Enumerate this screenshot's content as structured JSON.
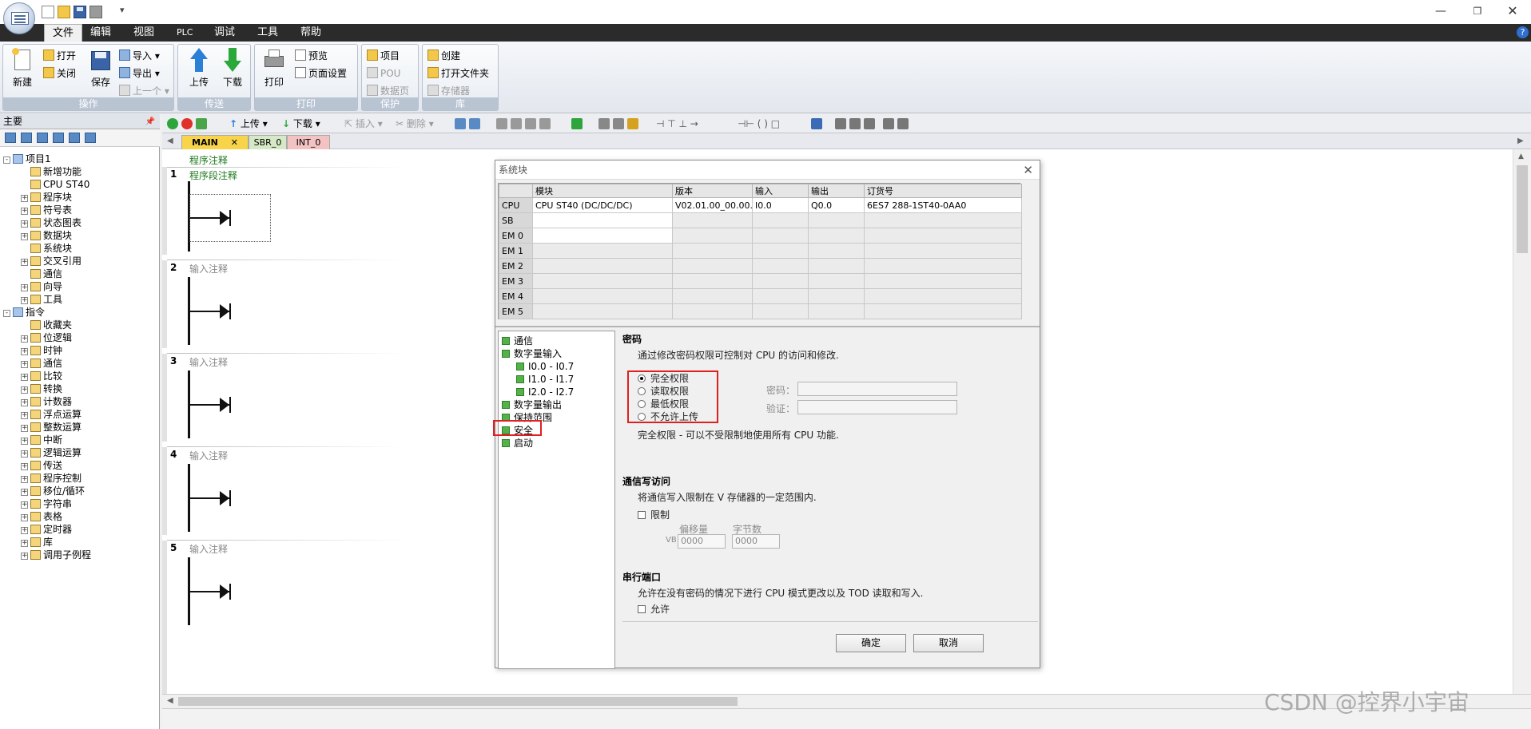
{
  "menu": {
    "items": [
      "文件",
      "编辑",
      "视图",
      "PLC",
      "调试",
      "工具",
      "帮助"
    ],
    "active": "文件"
  },
  "ribbon": {
    "groups": [
      {
        "label": "操作",
        "buttons": [
          "新建",
          "打开",
          "关闭",
          "保存",
          "导入",
          "导出",
          "上一个"
        ]
      },
      {
        "label": "传送",
        "buttons": [
          "上传",
          "下载"
        ]
      },
      {
        "label": "打印",
        "buttons": [
          "打印",
          "预览",
          "页面设置"
        ]
      },
      {
        "label": "保护",
        "buttons": [
          "项目",
          "POU",
          "数据页"
        ]
      },
      {
        "label": "库",
        "buttons": [
          "创建",
          "打开文件夹",
          "存储器"
        ]
      }
    ]
  },
  "left_pane": {
    "title": "主要",
    "tree": [
      {
        "label": "项目1",
        "level": 0,
        "exp": "-"
      },
      {
        "label": "新增功能",
        "level": 1,
        "exp": ""
      },
      {
        "label": "CPU ST40",
        "level": 1,
        "exp": ""
      },
      {
        "label": "程序块",
        "level": 1,
        "exp": "+"
      },
      {
        "label": "符号表",
        "level": 1,
        "exp": "+"
      },
      {
        "label": "状态图表",
        "level": 1,
        "exp": "+"
      },
      {
        "label": "数据块",
        "level": 1,
        "exp": "+"
      },
      {
        "label": "系统块",
        "level": 1,
        "exp": ""
      },
      {
        "label": "交叉引用",
        "level": 1,
        "exp": "+"
      },
      {
        "label": "通信",
        "level": 1,
        "exp": ""
      },
      {
        "label": "向导",
        "level": 1,
        "exp": "+"
      },
      {
        "label": "工具",
        "level": 1,
        "exp": "+"
      },
      {
        "label": "指令",
        "level": 0,
        "exp": "-"
      },
      {
        "label": "收藏夹",
        "level": 1,
        "exp": ""
      },
      {
        "label": "位逻辑",
        "level": 1,
        "exp": "+"
      },
      {
        "label": "时钟",
        "level": 1,
        "exp": "+"
      },
      {
        "label": "通信",
        "level": 1,
        "exp": "+"
      },
      {
        "label": "比较",
        "level": 1,
        "exp": "+"
      },
      {
        "label": "转换",
        "level": 1,
        "exp": "+"
      },
      {
        "label": "计数器",
        "level": 1,
        "exp": "+"
      },
      {
        "label": "浮点运算",
        "level": 1,
        "exp": "+"
      },
      {
        "label": "整数运算",
        "level": 1,
        "exp": "+"
      },
      {
        "label": "中断",
        "level": 1,
        "exp": "+"
      },
      {
        "label": "逻辑运算",
        "level": 1,
        "exp": "+"
      },
      {
        "label": "传送",
        "level": 1,
        "exp": "+"
      },
      {
        "label": "程序控制",
        "level": 1,
        "exp": "+"
      },
      {
        "label": "移位/循环",
        "level": 1,
        "exp": "+"
      },
      {
        "label": "字符串",
        "level": 1,
        "exp": "+"
      },
      {
        "label": "表格",
        "level": 1,
        "exp": "+"
      },
      {
        "label": "定时器",
        "level": 1,
        "exp": "+"
      },
      {
        "label": "库",
        "level": 1,
        "exp": "+"
      },
      {
        "label": "调用子例程",
        "level": 1,
        "exp": "+"
      }
    ]
  },
  "editor": {
    "toolbar": {
      "upload": "上传",
      "download": "下载",
      "insert": "插入",
      "delete": "删除"
    },
    "tabs": [
      "MAIN",
      "SBR_0",
      "INT_0"
    ],
    "program_comment": "程序注释",
    "rungs": [
      {
        "num": "1",
        "comment": "程序段注释"
      },
      {
        "num": "2",
        "comment": "输入注释"
      },
      {
        "num": "3",
        "comment": "输入注释"
      },
      {
        "num": "4",
        "comment": "输入注释"
      },
      {
        "num": "5",
        "comment": "输入注释"
      }
    ]
  },
  "dialog": {
    "title": "系统块",
    "table": {
      "headers": [
        "",
        "模块",
        "版本",
        "输入",
        "输出",
        "订货号"
      ],
      "rows": [
        [
          "CPU",
          "CPU ST40 (DC/DC/DC)",
          "V02.01.00_00.00...",
          "I0.0",
          "Q0.0",
          "6ES7 288-1ST40-0AA0"
        ],
        [
          "SB",
          "",
          "",
          "",
          "",
          ""
        ],
        [
          "EM 0",
          "",
          "",
          "",
          "",
          ""
        ],
        [
          "EM 1",
          "",
          "",
          "",
          "",
          ""
        ],
        [
          "EM 2",
          "",
          "",
          "",
          "",
          ""
        ],
        [
          "EM 3",
          "",
          "",
          "",
          "",
          ""
        ],
        [
          "EM 4",
          "",
          "",
          "",
          "",
          ""
        ],
        [
          "EM 5",
          "",
          "",
          "",
          "",
          ""
        ]
      ]
    },
    "config_tree": [
      {
        "label": "通信",
        "level": 0
      },
      {
        "label": "数字量输入",
        "level": 0
      },
      {
        "label": "I0.0 - I0.7",
        "level": 1
      },
      {
        "label": "I1.0 - I1.7",
        "level": 1
      },
      {
        "label": "I2.0 - I2.7",
        "level": 1
      },
      {
        "label": "数字量输出",
        "level": 0
      },
      {
        "label": "保持范围",
        "level": 0
      },
      {
        "label": "安全",
        "level": 0
      },
      {
        "label": "启动",
        "level": 0
      }
    ],
    "password": {
      "title": "密码",
      "description": "通过修改密码权限可控制对 CPU 的访问和修改.",
      "options": [
        "完全权限",
        "读取权限",
        "最低权限",
        "不允许上传"
      ],
      "selected": 0,
      "password_label": "密码：",
      "verify_label": "验证：",
      "note": "完全权限 - 可以不受限制地使用所有 CPU 功能."
    },
    "comm_write": {
      "title": "通信写访问",
      "description": "将通信写入限制在 V 存储器的一定范围内.",
      "restrict_label": "限制",
      "offset_label": "偏移量",
      "bytes_label": "字节数",
      "vb_label": "VB",
      "offset_value": "0000",
      "bytes_value": "0000"
    },
    "serial": {
      "title": "串行端口",
      "description": "允许在没有密码的情况下进行 CPU 模式更改以及 TOD 读取和写入.",
      "allow_label": "允许"
    },
    "ok": "确定",
    "cancel": "取消"
  },
  "watermark": "CSDN @控界小宇宙"
}
